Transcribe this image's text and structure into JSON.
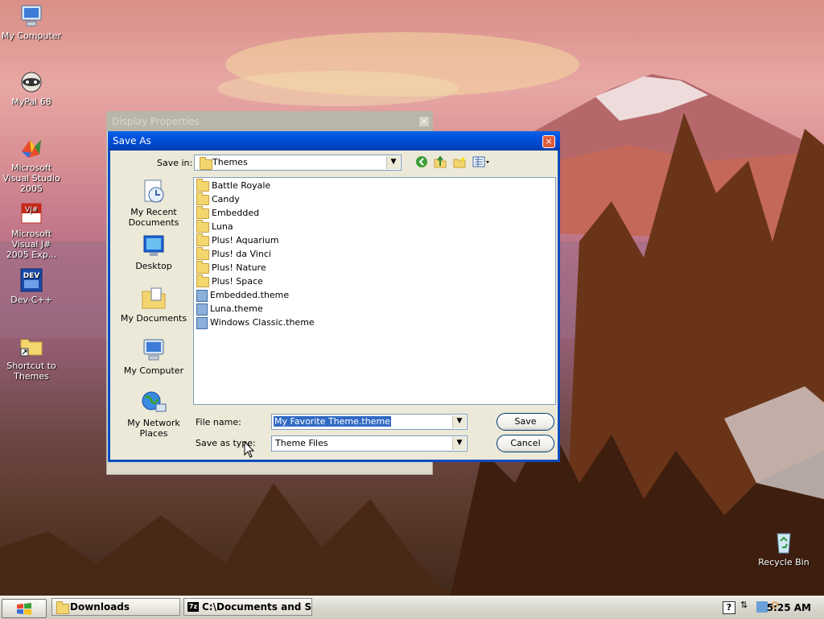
{
  "desktop": {
    "icons": [
      {
        "label": "My Computer"
      },
      {
        "label": "MyPal 68"
      },
      {
        "label": "Microsoft Visual Studio 2005"
      },
      {
        "label": "Microsoft Visual J# 2005 Exp..."
      },
      {
        "label": "Dev-C++"
      },
      {
        "label": "Shortcut to Themes"
      },
      {
        "label": "Recycle Bin"
      }
    ]
  },
  "background_window": {
    "title": "Display Properties",
    "close": "×"
  },
  "dialog": {
    "title": "Save As",
    "close": "×",
    "save_in_label": "Save in:",
    "save_in_value": "Themes",
    "places": [
      {
        "label": "My Recent Documents"
      },
      {
        "label": "Desktop"
      },
      {
        "label": "My Documents"
      },
      {
        "label": "My Computer"
      },
      {
        "label": "My Network Places"
      }
    ],
    "files": [
      {
        "name": "Battle Royale",
        "kind": "folder"
      },
      {
        "name": "Candy",
        "kind": "folder"
      },
      {
        "name": "Embedded",
        "kind": "folder"
      },
      {
        "name": "Luna",
        "kind": "folder"
      },
      {
        "name": "Plus! Aquarium",
        "kind": "folder"
      },
      {
        "name": "Plus! da Vinci",
        "kind": "folder"
      },
      {
        "name": "Plus! Nature",
        "kind": "folder"
      },
      {
        "name": "Plus! Space",
        "kind": "folder"
      },
      {
        "name": "Embedded.theme",
        "kind": "theme"
      },
      {
        "name": "Luna.theme",
        "kind": "theme"
      },
      {
        "name": "Windows Classic.theme",
        "kind": "theme"
      }
    ],
    "file_name_label": "File name:",
    "file_name_value": "My Favorite Theme.theme",
    "save_type_label": "Save as type:",
    "save_type_value": "Theme Files",
    "save_button": "Save",
    "cancel_button": "Cancel"
  },
  "taskbar": {
    "tasks": [
      {
        "label": "Downloads"
      },
      {
        "label": "C:\\Documents and Se..."
      }
    ],
    "clock": "5:25 AM"
  }
}
